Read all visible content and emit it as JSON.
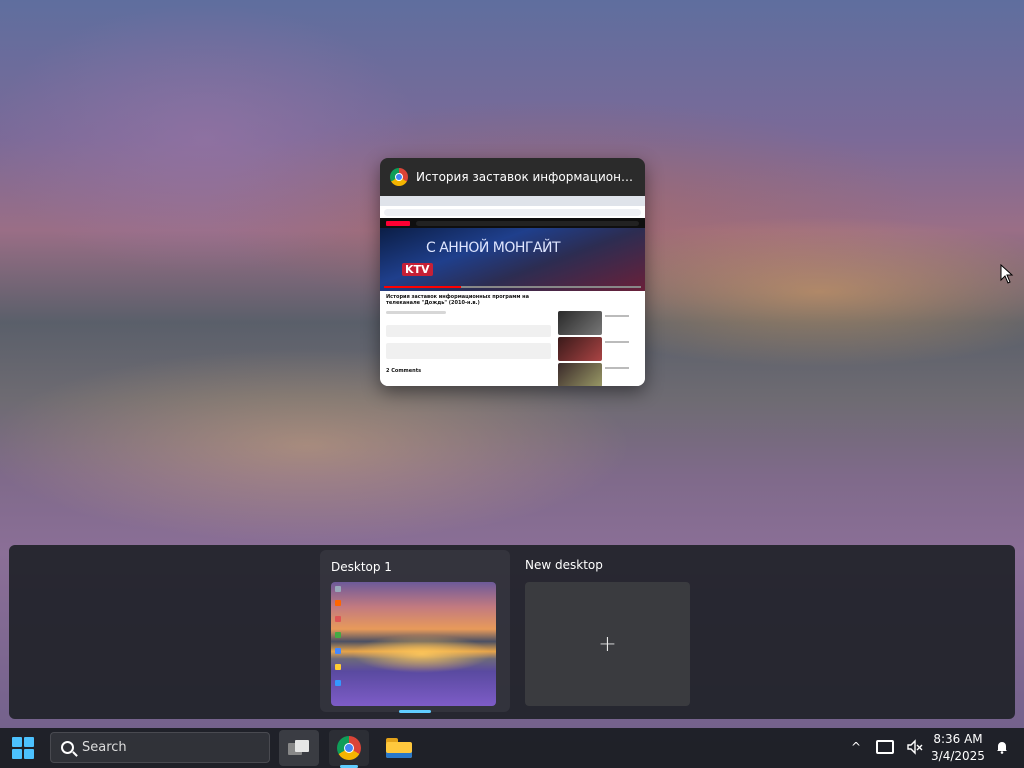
{
  "task_view": {
    "window": {
      "title": "История заставок информационных...",
      "app_icon": "chrome-icon",
      "preview": {
        "video_overlay_text": "С АННОЙ МОНГАЙТ",
        "channel_badge": "KTV",
        "video_title": "История заставок информационных программ на телеканале \"Дождь\" (2010-н.в.)",
        "comments_label": "2 Comments"
      }
    },
    "desktops": [
      {
        "label": "Desktop 1",
        "active": true
      },
      {
        "label": "New desktop",
        "active": false,
        "icon": "plus-icon"
      }
    ],
    "new_desktop_plus": "+"
  },
  "taskbar": {
    "search_placeholder": "Search",
    "pinned": [
      {
        "name": "task-view",
        "icon": "task-view-icon"
      },
      {
        "name": "chrome",
        "icon": "chrome-icon",
        "running": true
      },
      {
        "name": "file-explorer",
        "icon": "folder-icon"
      }
    ],
    "tray": {
      "chevron": "^",
      "time": "8:36 AM",
      "date": "3/4/2025"
    }
  },
  "colors": {
    "accent": "#60cdff",
    "start": "#4cc2ff"
  }
}
